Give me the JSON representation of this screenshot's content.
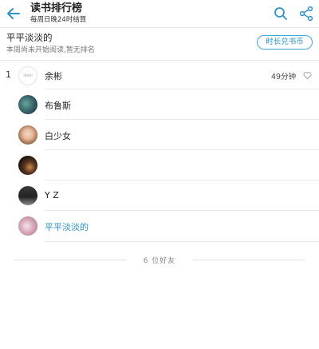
{
  "header": {
    "title": "读书排行榜",
    "subtitle": "每周日晚24时结算"
  },
  "me": {
    "name": "平平淡淡的",
    "status": "本周尚未开始阅读,暂无排名",
    "exchange_label": "时长兑书币"
  },
  "rows": [
    {
      "rank": "1",
      "name": "余彬",
      "duration": "49分钟",
      "avatar_text": "ikoki"
    },
    {
      "rank": "",
      "name": "布鲁斯",
      "duration": ""
    },
    {
      "rank": "",
      "name": "白少女",
      "duration": ""
    },
    {
      "rank": "",
      "name": "",
      "duration": ""
    },
    {
      "rank": "",
      "name": "Y Z",
      "duration": ""
    },
    {
      "rank": "",
      "name": "平平淡淡的",
      "duration": ""
    }
  ],
  "footer": {
    "friend_count_text": "6 位好友"
  },
  "colors": {
    "accent": "#2b93d3",
    "divider": "#e6e6e6"
  },
  "icons": [
    "back-arrow-icon",
    "search-icon",
    "share-icon",
    "heart-icon"
  ]
}
